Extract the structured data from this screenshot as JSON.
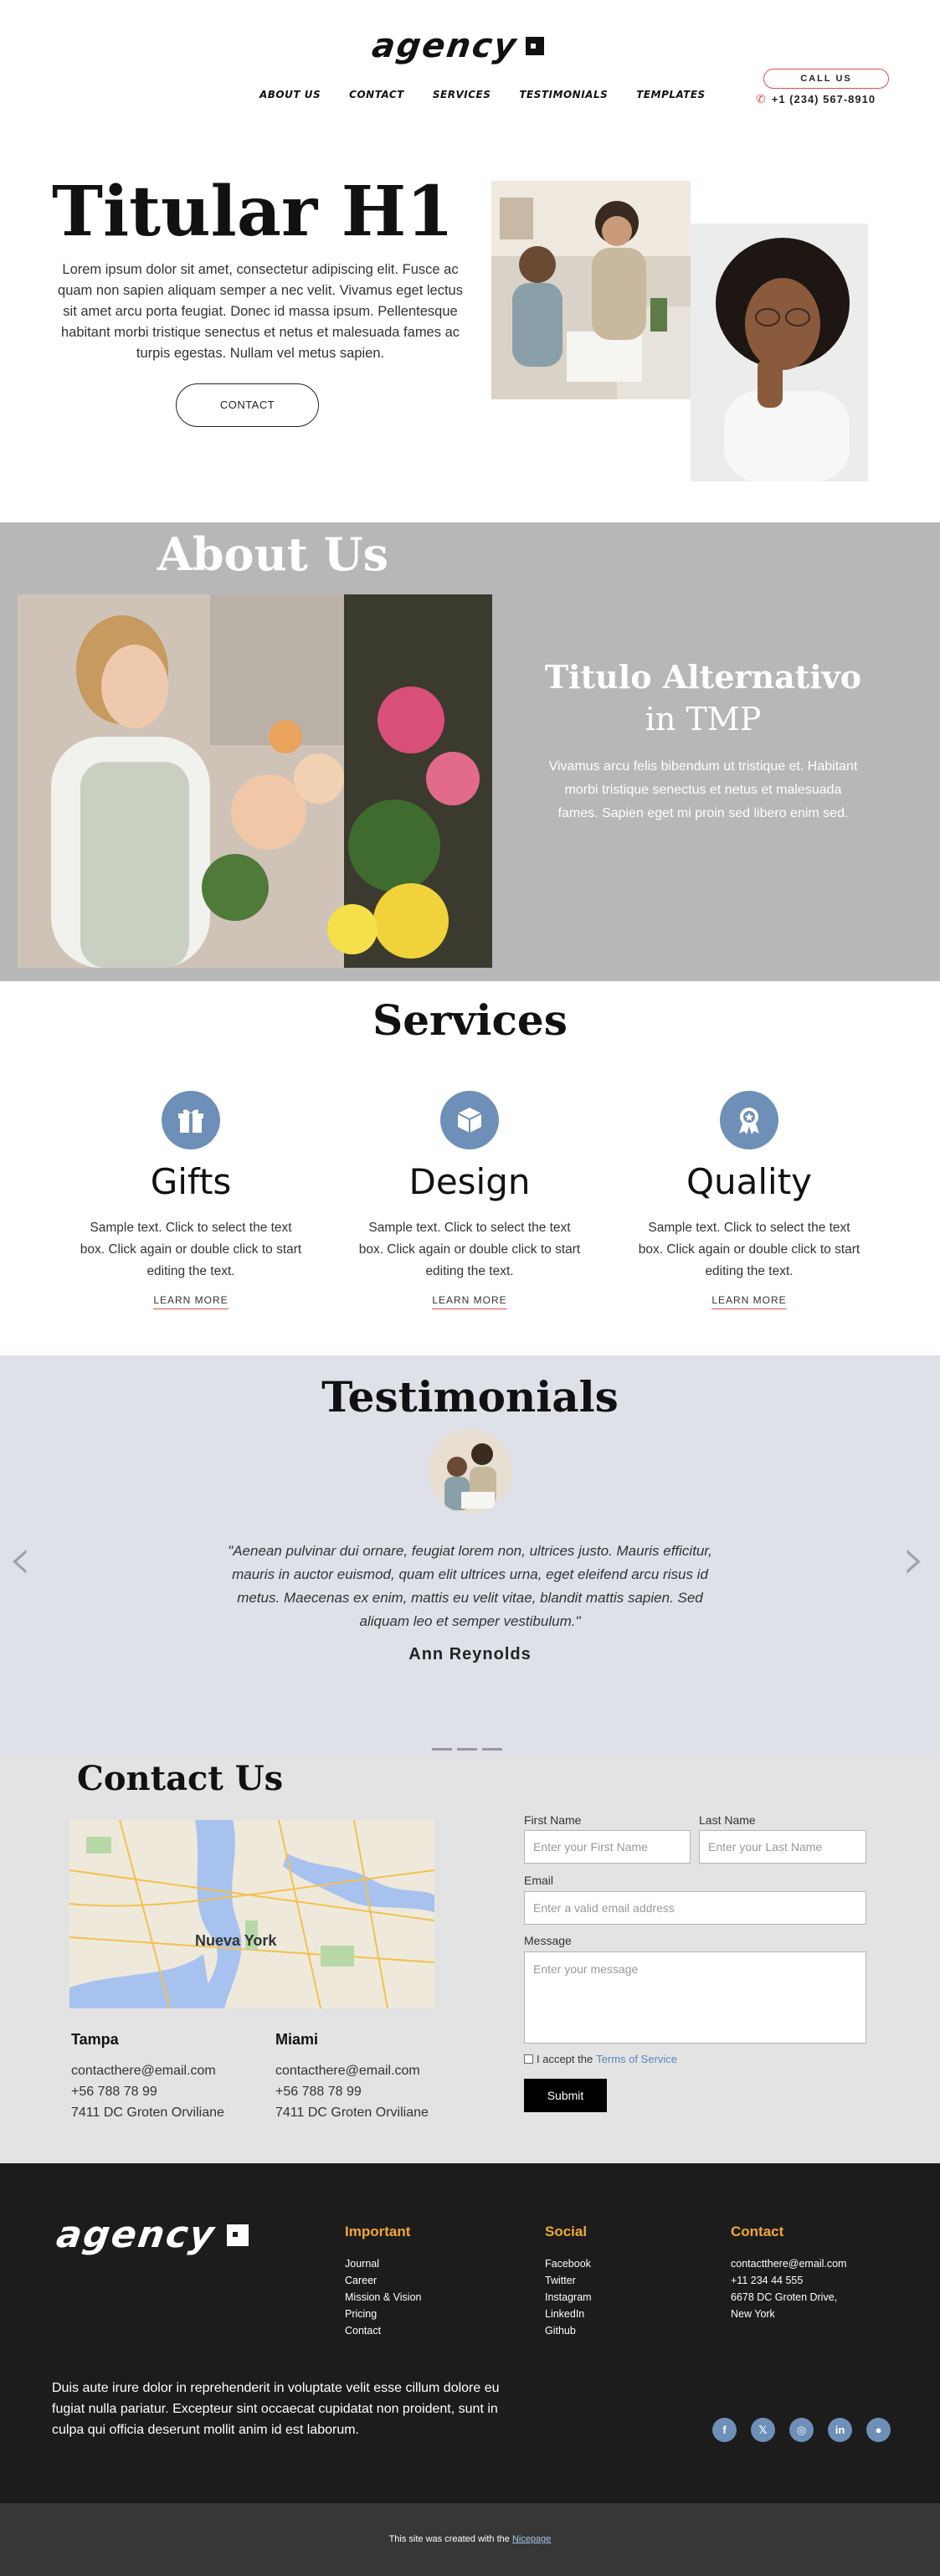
{
  "header": {
    "logo": "agency",
    "nav": [
      "ABOUT US",
      "CONTACT",
      "SERVICES",
      "TESTIMONIALS",
      "TEMPLATES"
    ],
    "call_label": "CALL US",
    "phone": "+1 (234) 567-8910"
  },
  "hero": {
    "title": "Titular H1",
    "text": "Lorem ipsum dolor sit amet, consectetur adipiscing elit. Fusce ac quam non sapien aliquam semper a nec velit. Vivamus eget lectus sit amet arcu porta feugiat. Donec id massa ipsum. Pellentesque habitant morbi tristique senectus et netus et malesuada fames ac turpis egestas. Nullam vel metus sapien.",
    "button": "CONTACT"
  },
  "about": {
    "title": "About Us",
    "alt_title_line1": "Titulo Alternativo",
    "alt_title_line2": "in TMP",
    "text": "Vivamus arcu felis bibendum ut tristique et. Habitant morbi tristique senectus et netus et malesuada fames. Sapien eget mi proin sed libero enim sed."
  },
  "services": {
    "title": "Services",
    "items": [
      {
        "name": "Gifts",
        "icon": "gift-icon",
        "text": "Sample text. Click to select the text box. Click again or double click to start editing the text.",
        "link": "LEARN MORE"
      },
      {
        "name": "Design",
        "icon": "box-icon",
        "text": "Sample text. Click to select the text box. Click again or double click to start editing the text.",
        "link": "LEARN MORE"
      },
      {
        "name": "Quality",
        "icon": "award-icon",
        "text": "Sample text. Click to select the text box. Click again or double click to start editing the text.",
        "link": "LEARN MORE"
      }
    ]
  },
  "testimonials": {
    "title": "Testimonials",
    "quote": "\"Aenean pulvinar dui ornare, feugiat lorem non, ultrices justo. Mauris efficitur, mauris in auctor euismod, quam elit ultrices urna, eget eleifend arcu risus id metus. Maecenas ex enim, mattis eu velit vitae, blandit mattis sapien. Sed aliquam leo et semper vestibulum.\"",
    "name": "Ann Reynolds"
  },
  "contact": {
    "title": "Contact Us",
    "map_label": "Nueva York",
    "offices": [
      {
        "city": "Tampa",
        "email": "contacthere@email.com",
        "phone": "+56 788 78 99",
        "address": "7411 DC Groten Orviliane"
      },
      {
        "city": "Miami",
        "email": "contacthere@email.com",
        "phone": "+56 788 78 99",
        "address": "7411 DC Groten Orviliane"
      }
    ],
    "form": {
      "first_label": "First Name",
      "first_placeholder": "Enter your First Name",
      "last_label": "Last Name",
      "last_placeholder": "Enter your Last Name",
      "email_label": "Email",
      "email_placeholder": "Enter a valid email address",
      "message_label": "Message",
      "message_placeholder": "Enter your message",
      "accept": "I accept the",
      "terms": "Terms of Service",
      "submit": "Submit"
    }
  },
  "footer": {
    "logo": "agency",
    "important": {
      "title": "Important",
      "items": [
        "Journal",
        "Career",
        "Mission & Vision",
        "Pricing",
        "Contact"
      ]
    },
    "social": {
      "title": "Social",
      "items": [
        "Facebook",
        "Twitter",
        "Instagram",
        "LinkedIn",
        "Github"
      ]
    },
    "contact": {
      "title": "Contact",
      "items": [
        "contactthere@email.com",
        "+11 234 44 555",
        "6678 DC Groten Drive,",
        "New York"
      ]
    },
    "about": "Duis aute irure dolor in reprehenderit in voluptate velit esse cillum dolore eu fugiat nulla pariatur. Excepteur sint occaecat cupidatat non proident, sunt in culpa qui officia deserunt mollit anim id est laborum.",
    "bottom_text": "This site was created with the",
    "bottom_link": "Nicepage"
  },
  "colors": {
    "accent": "#6e8fb8",
    "footer_heading": "#f0a836",
    "call_border": "#e24c4c"
  }
}
